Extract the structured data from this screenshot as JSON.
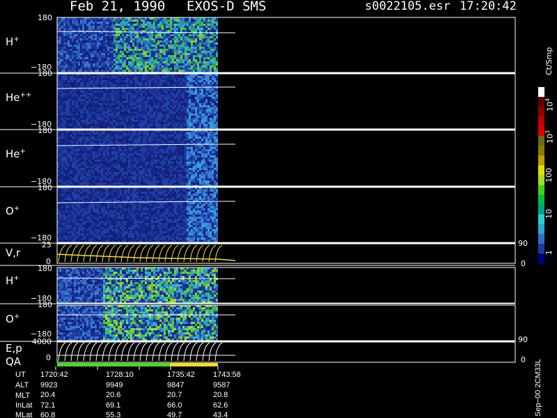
{
  "header": {
    "date": "Feb 21, 1990",
    "instrument": "EXOS-D SMS",
    "file": "s0022105.esr",
    "time": "17:20:42"
  },
  "panels": [
    {
      "label": "H",
      "sup": "+",
      "top": "180",
      "bottom": "−180"
    },
    {
      "label": "He",
      "sup": "++",
      "top": "180",
      "bottom": "−180"
    },
    {
      "label": "He",
      "sup": "+",
      "top": "180",
      "bottom": "−180"
    },
    {
      "label": "O",
      "sup": "+",
      "top": "180",
      "bottom": "−180"
    },
    {
      "label": "V,r",
      "sup": "",
      "top": "25",
      "bottom": "0",
      "right_top": "90",
      "right_bottom": "0"
    },
    {
      "label": "H",
      "sup": "+",
      "top": "180",
      "bottom": "−180"
    },
    {
      "label": "O",
      "sup": "+",
      "top": "180",
      "bottom": "−180"
    },
    {
      "label": "E,p",
      "sup": "",
      "top": "4000",
      "bottom": "0",
      "right_top": "90",
      "right_bottom": "0"
    }
  ],
  "qa_label": "QA",
  "colorbar": {
    "unit": "Ct/Smp",
    "labels": [
      "1",
      "10",
      "100",
      "10",
      "10"
    ],
    "sups": [
      "",
      "",
      "",
      "3",
      "4"
    ],
    "colors": [
      "#000080",
      "#1c3a9e",
      "#2e6fc8",
      "#2aa6d8",
      "#28d0d0",
      "#00a080",
      "#00c040",
      "#40d020",
      "#a0e020",
      "#e0e000",
      "#c0a000",
      "#8a7a00",
      "#6a6a20",
      "#e00000",
      "#c00000",
      "#900000",
      "#600000",
      "#ffffff"
    ]
  },
  "footer": {
    "row_labels": [
      "UT",
      "ALT",
      "MLT",
      "InLat",
      "MLat"
    ],
    "columns": [
      [
        "1720:42",
        "9923",
        "20.4",
        "72.1",
        "60.8"
      ],
      [
        "1728:10",
        "9949",
        "20.6",
        "69.1",
        "55.3"
      ],
      [
        "1735:42",
        "9847",
        "20.7",
        "66.0",
        "49.7"
      ],
      [
        "1743:58",
        "9587",
        "20.8",
        "62.6",
        "43.4"
      ]
    ],
    "side_note": "Sep−00  2CM33L"
  },
  "qa_bar": [
    {
      "color": "#40e020",
      "fraction": 0.7
    },
    {
      "color": "#f0e020",
      "fraction": 0.3
    }
  ]
}
